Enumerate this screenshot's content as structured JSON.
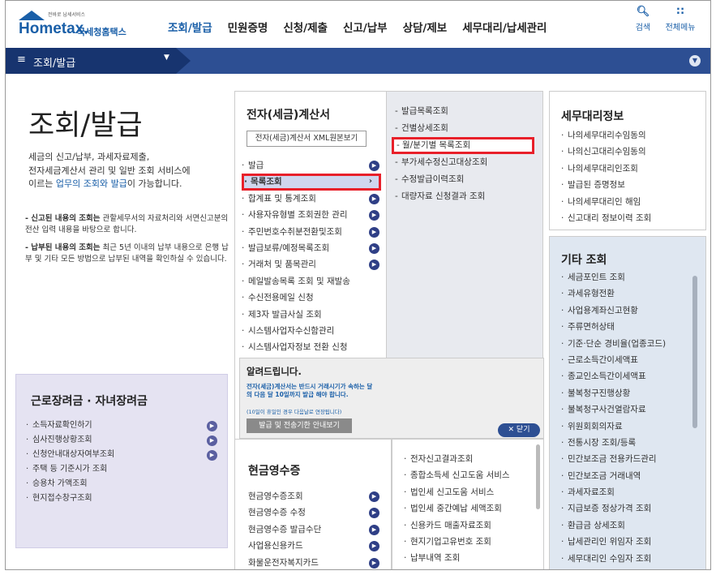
{
  "header": {
    "logo_small": "전바로 납세서비스",
    "logo_word": "Hometax.",
    "logo_sub": "국세청홈택스",
    "nav": [
      "조회/발급",
      "민원증명",
      "신청/제출",
      "신고/납부",
      "상담/제보",
      "세무대리/납세관리"
    ],
    "search_label": "검색",
    "menu_label": "전체메뉴"
  },
  "bar": {
    "title": "조회/발급"
  },
  "page": {
    "title": "조회/발급",
    "desc_1": "세금의 신고/납부, 과세자료제출,",
    "desc_2": "전자세금계산서 관리 및 일반 조회 서비스에",
    "desc_3a": "이르는 ",
    "desc_3b": "업무의 조회와 발급",
    "desc_3c": "이 가능합니다.",
    "note1_bold": "- 신고된 내용의 조회는",
    "note1_rest": " 관할세무서의 자료처리와 서면신고분의 전산 입력 내용을 바탕으로 합니다.",
    "note2_bold": "- 납부된 내용의 조회는",
    "note2_rest": " 최근 5년 이내의 납부 내용으로 은행 납부 및 기타 모든 방법으로 납부된 내역을 확인하실 수 있습니다."
  },
  "left_box": {
    "title": "근로장려금 · 자녀장려금",
    "items": [
      "소득자료확인하기",
      "심사진행상황조회",
      "신청안내대상자여부조회",
      "주택 등 기준시가 조회",
      "승용차 가액조회",
      "현지접수창구조회"
    ]
  },
  "mid": {
    "title": "전자(세금)계산서",
    "xml_button": "전자(세금)계산서 XML원본보기",
    "items": [
      "발급",
      "목록조회",
      "합계표 및 통계조회",
      "사용자유형별 조회권한 관리",
      "주민번호수취분전환및조회",
      "발급보류/예정목록조회",
      "거래처 및 품목관리",
      "메일발송목록 조회 및 재발송",
      "수신전용메일 신청",
      "제3자 발급사실 조회",
      "시스템사업자수신함관리",
      "시스템사업자정보 전환 신청"
    ]
  },
  "sub": {
    "items": [
      "발급목록조회",
      "건별상세조회",
      "월/분기별 목록조회",
      "부가세수정신고대상조회",
      "수정발급이력조회",
      "대량자료 신청결과 조회"
    ]
  },
  "notice": {
    "title": "알려드립니다.",
    "text": "전자(세금)계산서는 반드시 거래시기가 속하는 달의 다음 달 10일까지 발급 해야 합니다.",
    "small": "(10일이 휴일인 경우 다음날로 연장됩니다)",
    "button": "발급 및 전송기한 안내보기",
    "close": "✕ 닫기"
  },
  "receipts": {
    "title": "현금영수증",
    "items": [
      "현금영수증조회",
      "현금영수증 수정",
      "현금영수증 발급수단",
      "사업용신용카드",
      "화물운전자복지카드"
    ]
  },
  "mid2": {
    "items": [
      "전자신고결과조회",
      "종합소득세 신고도움 서비스",
      "법인세 신고도움 서비스",
      "법인세 중간예납 세액조회",
      "신용카드 매출자료조회",
      "현지기업고유번호 조회",
      "납부내역 조회"
    ]
  },
  "tax_agent": {
    "title": "세무대리정보",
    "items": [
      "나의세무대리수임동의",
      "나의신고대리수임동의",
      "나의세무대리인조회",
      "발급된 증명정보",
      "나의세무대리인 해임",
      "신고대리 정보이력 조회"
    ]
  },
  "other": {
    "title": "기타 조회",
    "items": [
      "세금포인트 조회",
      "과세유형전환",
      "사업용계좌신고현황",
      "주류면허상태",
      "기준·단순 경비율(업종코드)",
      "근로소득간이세액표",
      "종교인소득간이세액표",
      "불복청구진행상황",
      "불복청구사건열람자료",
      "위원회회의자료",
      "전통시장 조회/등록",
      "민간보조금 전용카드관리",
      "민간보조금 거래내역",
      "과세자료조회",
      "지급보증 정상가격 조회",
      "환급금 상세조회",
      "납세관리인 위임자 조회",
      "세무대리인 수임자 조회"
    ]
  }
}
